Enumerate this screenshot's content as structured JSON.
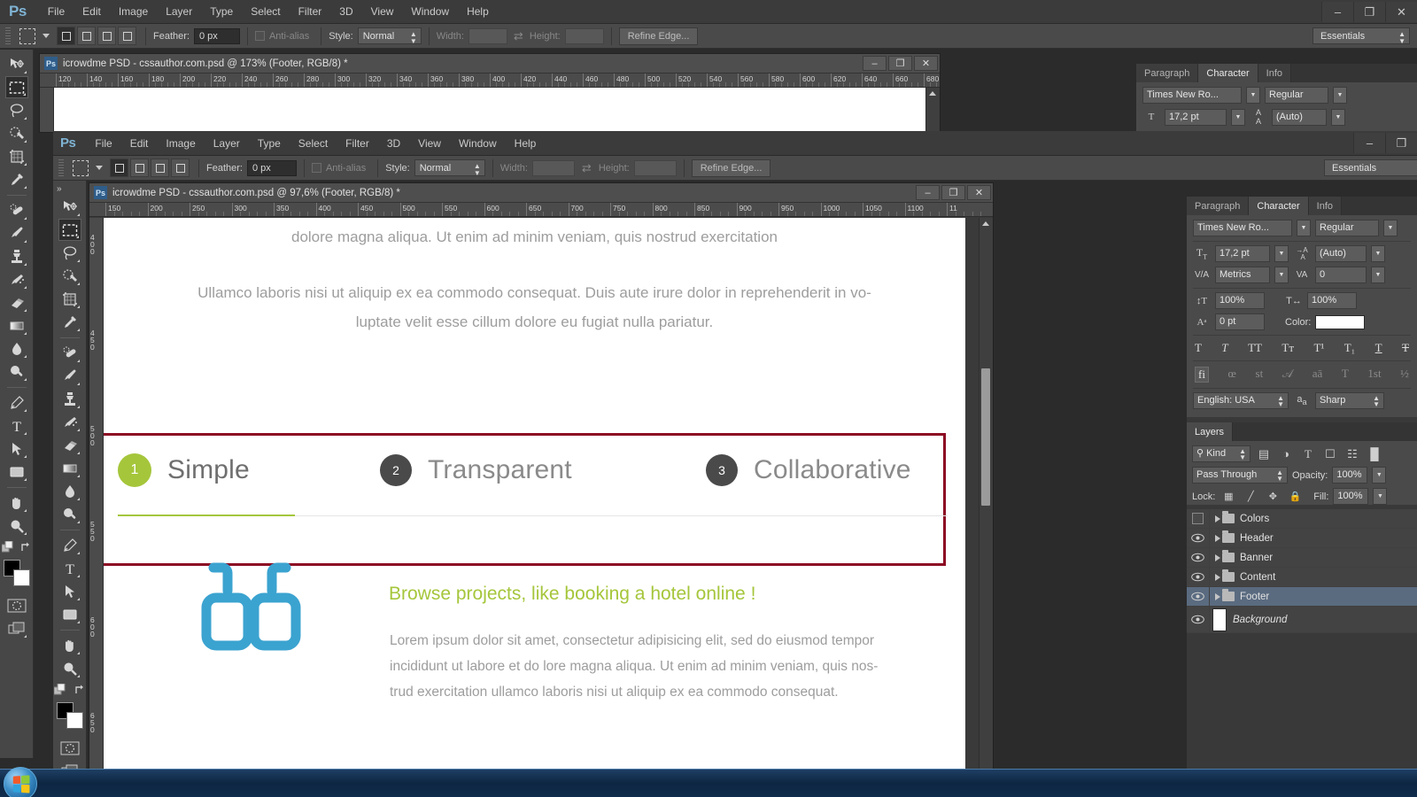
{
  "app": {
    "logo": "Ps",
    "menu": [
      "File",
      "Edit",
      "Image",
      "Layer",
      "Type",
      "Select",
      "Filter",
      "3D",
      "View",
      "Window",
      "Help"
    ],
    "window_buttons": {
      "minimize": "–",
      "restore": "❐",
      "close": "✕"
    },
    "workspace": "Essentials"
  },
  "options_bar": {
    "feather_label": "Feather:",
    "feather_value": "0 px",
    "antialias_label": "Anti-alias",
    "style_label": "Style:",
    "style_value": "Normal",
    "width_label": "Width:",
    "width_value": "",
    "height_label": "Height:",
    "height_value": "",
    "refine_edge": "Refine Edge..."
  },
  "outer_document": {
    "badge": "Ps",
    "title": "icrowdme PSD - cssauthor.com.psd @ 173%  (Footer, RGB/8) *",
    "ruler_ticks": [
      "120",
      "140",
      "160",
      "180",
      "200",
      "220",
      "240",
      "260",
      "280",
      "300",
      "320",
      "340",
      "360",
      "380",
      "400",
      "420",
      "440",
      "460",
      "480",
      "500",
      "520",
      "540",
      "560",
      "580",
      "600",
      "620",
      "640",
      "660",
      "680"
    ],
    "buttons": {
      "minimize": "–",
      "restore": "❐",
      "close": "✕"
    }
  },
  "inner_document": {
    "badge": "Ps",
    "title": "icrowdme PSD - cssauthor.com.psd @ 97,6%  (Footer, RGB/8) *",
    "ruler_ticks": [
      "150",
      "200",
      "250",
      "300",
      "350",
      "400",
      "450",
      "500",
      "550",
      "600",
      "650",
      "700",
      "750",
      "800",
      "850",
      "900",
      "950",
      "1000",
      "1050",
      "1100",
      "11"
    ],
    "ruler_v_ticks": [
      "400",
      "450",
      "500",
      "550",
      "600",
      "650"
    ],
    "buttons": {
      "minimize": "–",
      "restore": "❐",
      "close": "✕"
    }
  },
  "canvas": {
    "paragraph_top": "dolore magna aliqua. Ut enim ad minim veniam, quis nostrud exercitation",
    "paragraph_2_line1": "Ullamco laboris nisi ut aliquip ex ea commodo consequat. Duis aute irure dolor in reprehenderit in vo-",
    "paragraph_2_line2": "luptate velit esse cillum dolore eu fugiat nulla pariatur.",
    "tabs": [
      {
        "number": "1",
        "label": "Simple",
        "circle_color": "#a5c63b",
        "label_color": "#6f6f6f",
        "active": true
      },
      {
        "number": "2",
        "label": "Transparent",
        "circle_color": "#4a4a4a",
        "label_color": "#8a8a8a",
        "active": false
      },
      {
        "number": "3",
        "label": "Collaborative",
        "circle_color": "#4a4a4a",
        "label_color": "#8a8a8a",
        "active": false
      }
    ],
    "promo_heading": "Browse projects, like booking a hotel online !",
    "promo_body_line1": "Lorem ipsum dolor sit amet, consectetur adipisicing elit, sed do eiusmod tempor",
    "promo_body_line2": "incididunt ut labore et do lore magna aliqua. Ut enim ad minim veniam, quis nos-",
    "promo_body_line3": "trud exercitation ullamco laboris nisi ut aliquip ex ea commodo consequat.",
    "accent_green": "#a5c63b",
    "glasses_icon_color": "#3ba3d0",
    "selection_border_color": "#8c0a23"
  },
  "character_panel": {
    "tabs": [
      "Paragraph",
      "Character",
      "Info"
    ],
    "active_tab": "Character",
    "font_family": "Times New Ro...",
    "font_style": "Regular",
    "font_size": "17,2 pt",
    "leading": "(Auto)",
    "kerning": "Metrics",
    "tracking": "0",
    "vertical_scale": "100%",
    "horizontal_scale": "100%",
    "baseline_shift": "0 pt",
    "color_label": "Color:",
    "color_value": "#ffffff",
    "style_buttons": [
      "T",
      "T",
      "TT",
      "Tᴛ",
      "T¹",
      "T₁",
      "T",
      "T"
    ],
    "opentype_buttons": [
      "fi",
      "œ",
      "st",
      "𝒜",
      "aā",
      "T",
      "1st",
      "½"
    ],
    "language": "English: USA",
    "antialias_method": "Sharp",
    "aa_icon": "aa"
  },
  "layers_panel": {
    "tab": "Layers",
    "filter_kind": "Kind",
    "filter_icons": [
      "image-filter-icon",
      "adjustment-filter-icon",
      "type-filter-icon",
      "shape-filter-icon",
      "smartobject-filter-icon"
    ],
    "blend_mode": "Pass Through",
    "opacity_label": "Opacity:",
    "opacity_value": "100%",
    "lock_label": "Lock:",
    "fill_label": "Fill:",
    "fill_value": "100%",
    "layers": [
      {
        "name": "Colors",
        "visible": false,
        "type": "group",
        "selected": false
      },
      {
        "name": "Header",
        "visible": true,
        "type": "group",
        "selected": false
      },
      {
        "name": "Banner",
        "visible": true,
        "type": "group",
        "selected": false
      },
      {
        "name": "Content",
        "visible": true,
        "type": "group",
        "selected": false
      },
      {
        "name": "Footer",
        "visible": true,
        "type": "group",
        "selected": true
      },
      {
        "name": "Background",
        "visible": true,
        "type": "background",
        "selected": false
      }
    ]
  },
  "toolbar": {
    "tools": [
      "move-tool",
      "rectangular-marquee-tool",
      "lasso-tool",
      "quick-selection-tool",
      "crop-tool",
      "eyedropper-tool",
      "healing-brush-tool",
      "brush-tool",
      "clone-stamp-tool",
      "history-brush-tool",
      "eraser-tool",
      "gradient-tool",
      "blur-tool",
      "dodge-tool",
      "pen-tool",
      "type-tool",
      "path-selection-tool",
      "rectangle-tool",
      "hand-tool",
      "zoom-tool"
    ],
    "foreground_color": "#000000",
    "background_color": "#ffffff",
    "quick-mask-icon": "quick-mask-mode",
    "screen-mode-icon": "screen-mode"
  },
  "taskbar": {
    "start_button": "start-orb"
  }
}
